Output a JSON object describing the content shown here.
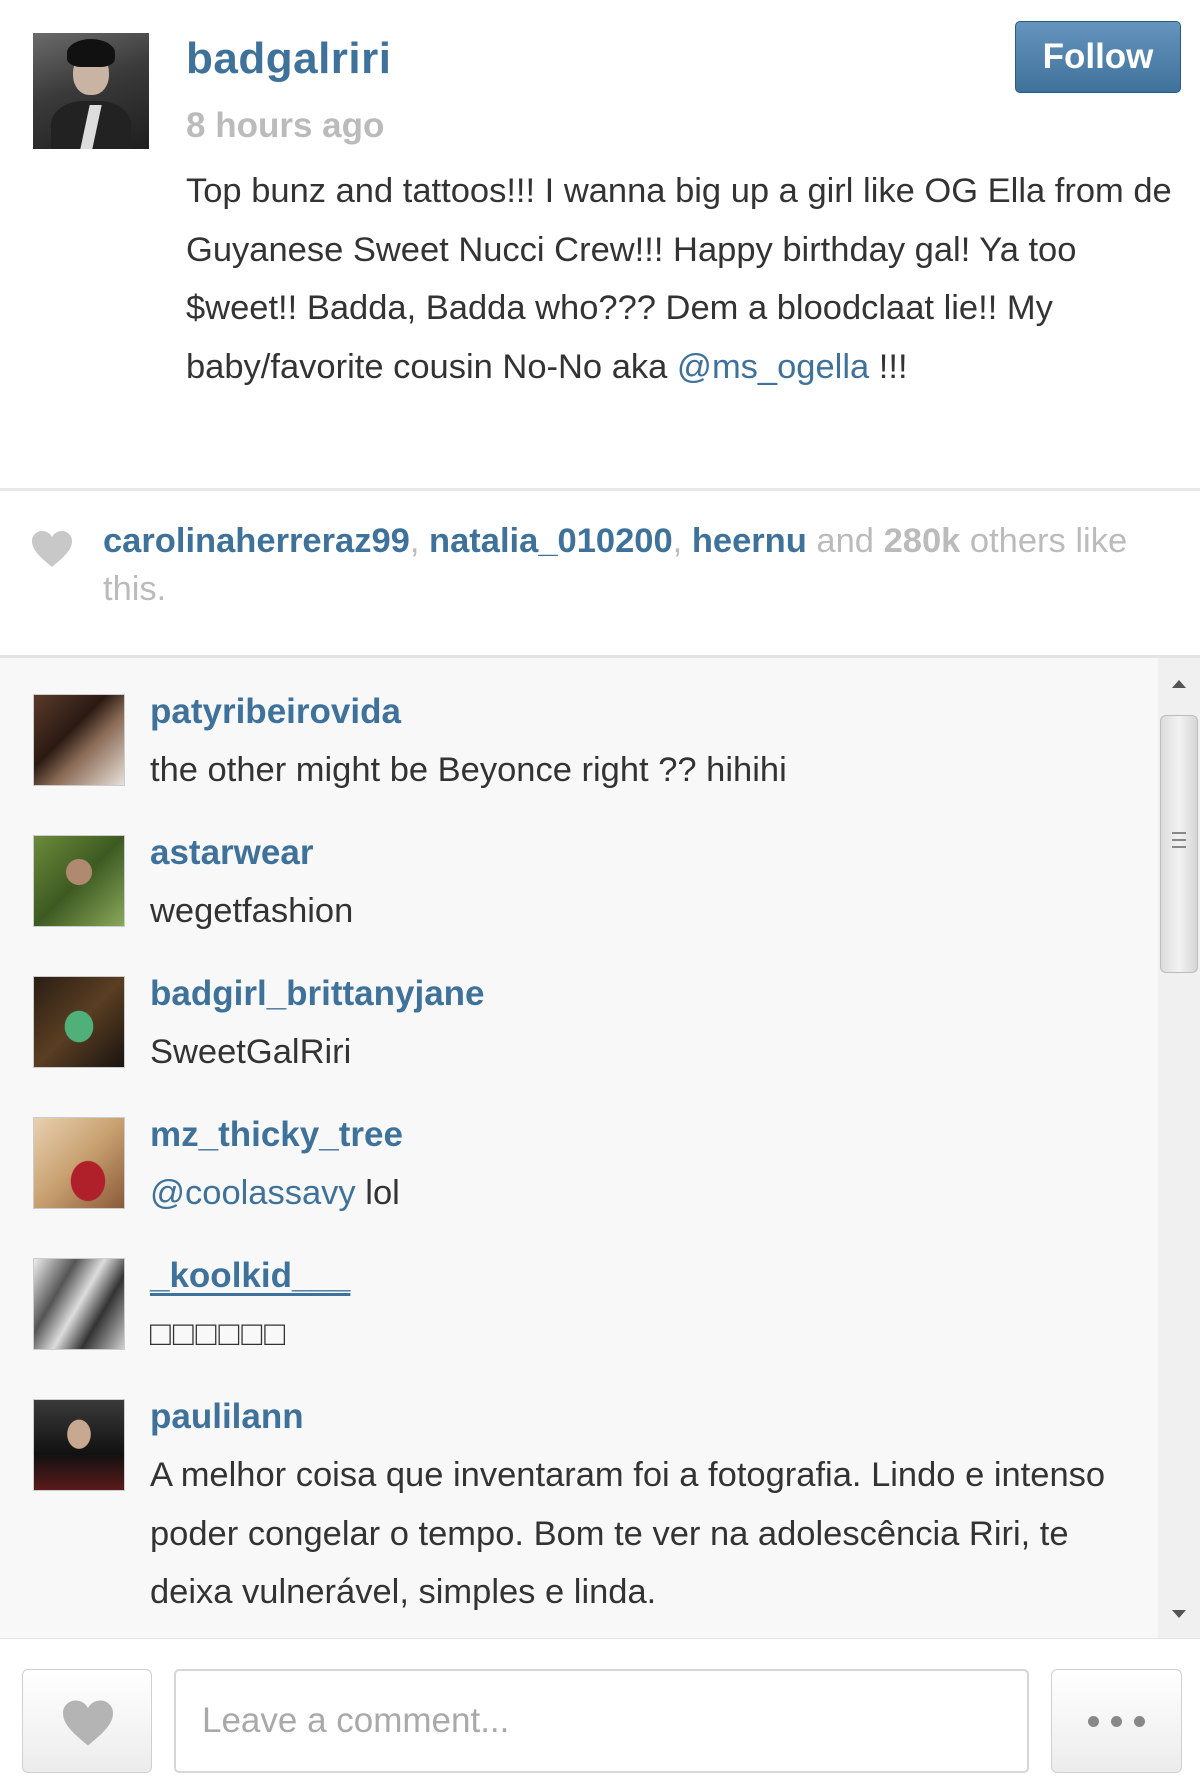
{
  "post": {
    "owner_username": "badgalriri",
    "timestamp": "8 hours ago",
    "follow_label": "Follow",
    "caption_text": "Top bunz and tattoos!!! I wanna big up a girl like OG Ella from de Guyanese Sweet Nucci Crew!!! Happy birthday gal! Ya too $weet!! Badda, Badda who??? Dem a bloodclaat lie!! My baby/favorite cousin No-No aka ",
    "caption_mention": "@ms_ogella",
    "caption_tail": " !!!"
  },
  "likes": {
    "likers": [
      "carolinaherreraz99",
      "natalia_010200",
      "heernu"
    ],
    "separator": ", ",
    "and_text": " and ",
    "count": "280k",
    "suffix": " others like this."
  },
  "comments": [
    {
      "username": "patyribeirovida",
      "text": "the other might be Beyonce right ?? hihihi"
    },
    {
      "username": "astarwear",
      "text": "wegetfashion"
    },
    {
      "username": "badgirl_brittanyjane",
      "text": "SweetGalRiri"
    },
    {
      "username": "mz_thicky_tree",
      "mention": "@coolassavy",
      "text": " lol"
    },
    {
      "username": "_koolkid___",
      "text": "□□□□□□"
    },
    {
      "username": "paulilann",
      "text": "A melhor coisa que inventaram foi a fotografia. Lindo e intenso poder congelar o tempo. Bom te ver na adolescência Riri, te deixa vulnerável, simples e linda."
    }
  ],
  "footer": {
    "comment_placeholder": "Leave a comment..."
  },
  "icons": {
    "like": "heart-icon",
    "more": "ellipsis-icon",
    "scroll_up": "arrow-up-icon",
    "scroll_down": "arrow-down-icon"
  },
  "colors": {
    "link": "#3f729b",
    "muted": "#bbbbbb",
    "text": "#333333",
    "follow_button": "#3f729b"
  }
}
